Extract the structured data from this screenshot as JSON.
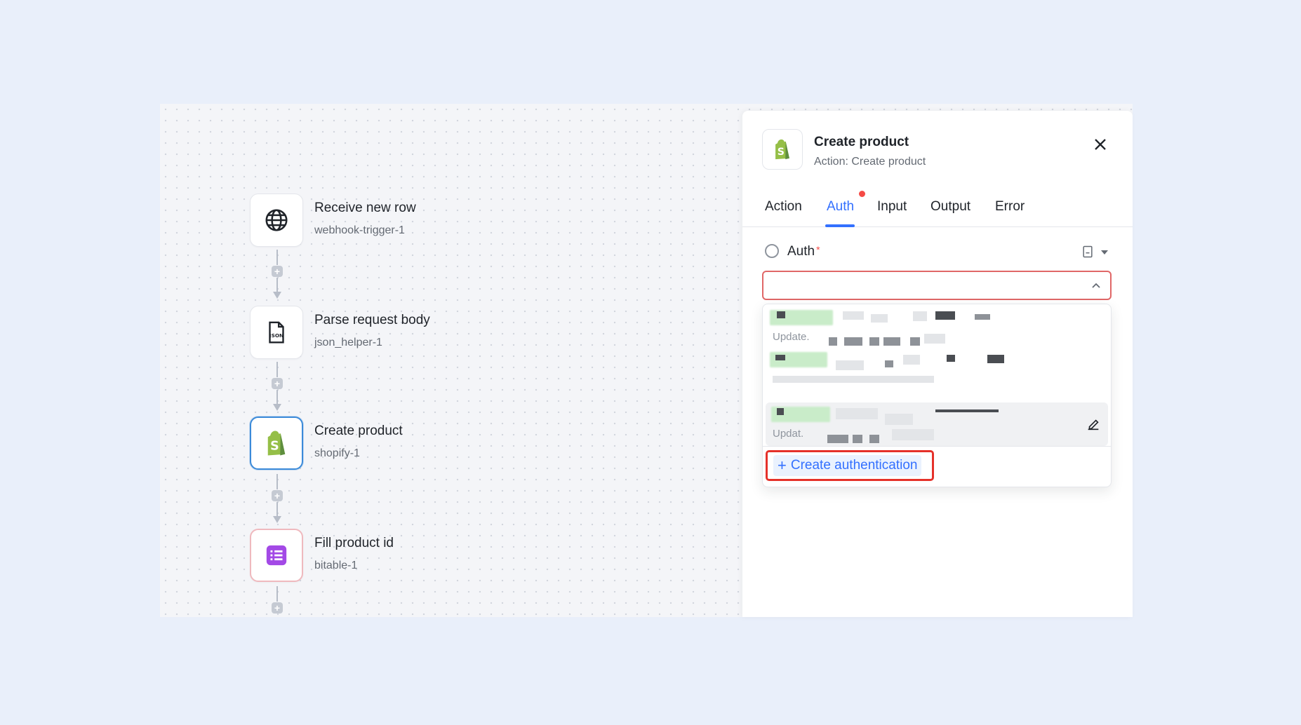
{
  "nodes": [
    {
      "title": "Receive new row",
      "subtitle": "webhook-trigger-1",
      "icon": "globe-icon"
    },
    {
      "title": "Parse request body",
      "subtitle": "json_helper-1",
      "icon": "json-file-icon",
      "icon_text": "JSON"
    },
    {
      "title": "Create product",
      "subtitle": "shopify-1",
      "icon": "shopify-icon"
    },
    {
      "title": "Fill product id",
      "subtitle": "bitable-1",
      "icon": "bitable-icon"
    }
  ],
  "panel": {
    "title": "Create product",
    "subtitle": "Action: Create product",
    "tabs": [
      "Action",
      "Auth",
      "Input",
      "Output",
      "Error"
    ],
    "active_tab": "Auth",
    "auth_label": "Auth",
    "required_mark": "*",
    "select_value": "",
    "options": [
      {
        "name": "",
        "meta": "Update."
      },
      {
        "name": "",
        "meta": ""
      },
      {
        "name": "",
        "meta": "Updat."
      }
    ],
    "create_auth_label": "Create authentication"
  },
  "colors": {
    "accent": "#3370ff",
    "error": "#e5312a",
    "shopify_green": "#95bf47",
    "bitable_purple": "#a349e6"
  }
}
